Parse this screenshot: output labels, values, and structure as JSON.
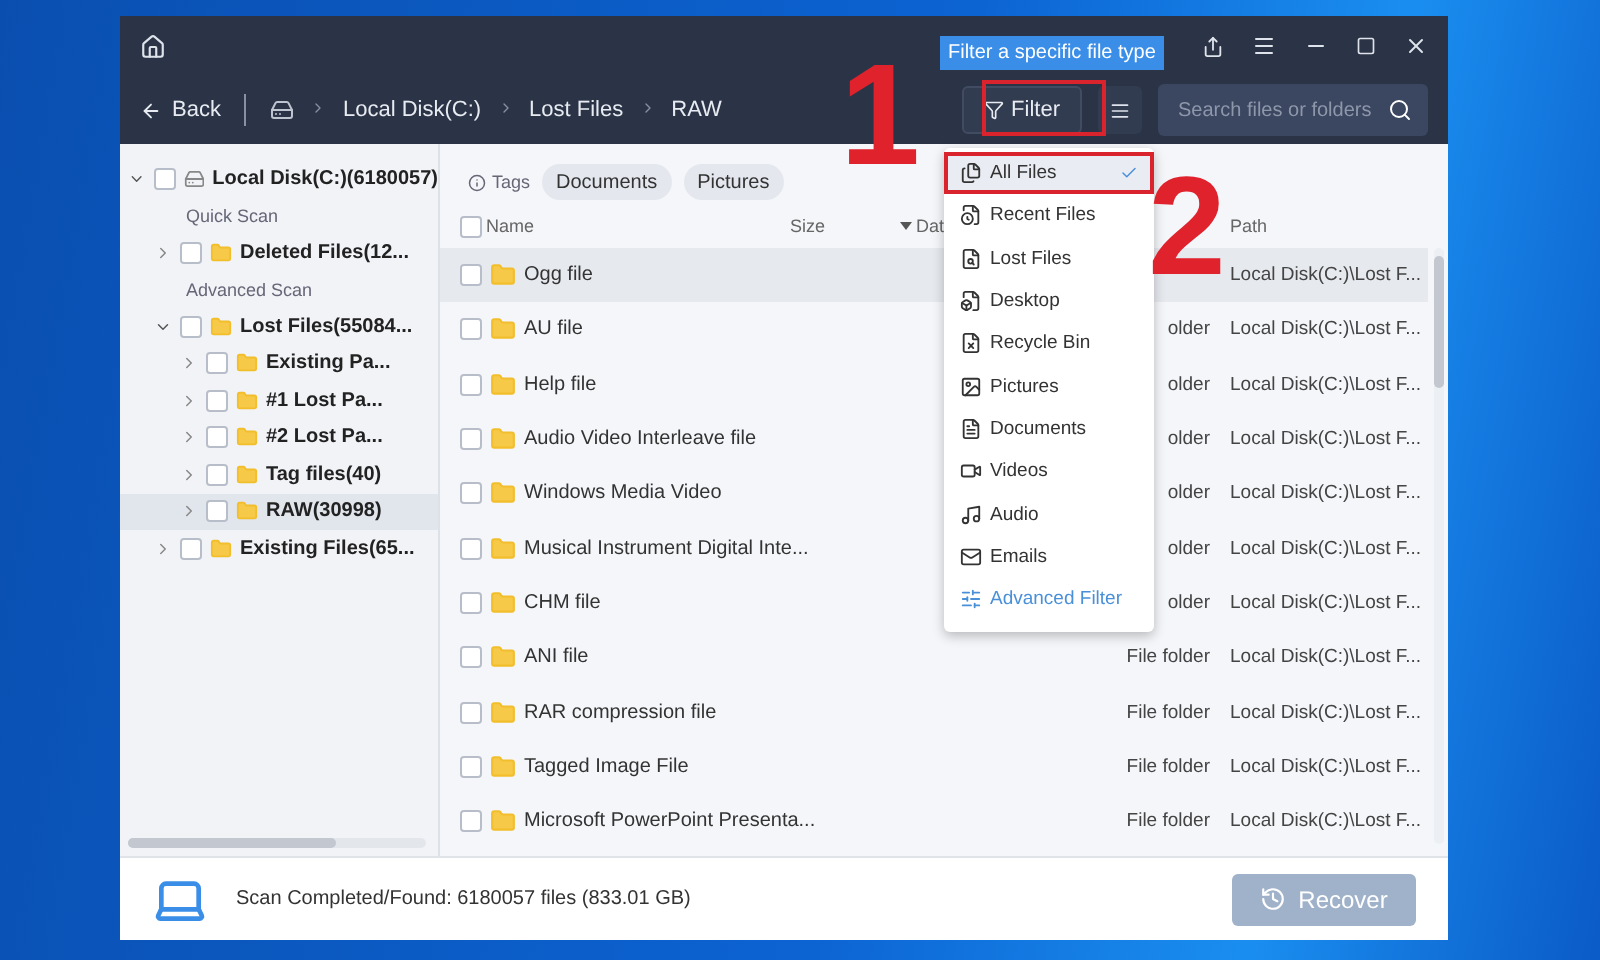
{
  "titlebar": {
    "tooltip": "Filter a specific file type"
  },
  "nav": {
    "back": "Back",
    "breadcrumbs": [
      "Local Disk(C:)",
      "Lost Files",
      "RAW"
    ],
    "filter": "Filter",
    "search": {
      "placeholder": "Search files or folders"
    }
  },
  "sidebar": {
    "tree": [
      {
        "kind": "node",
        "label": "Local Disk(C:)(6180057)",
        "expanded": true,
        "checked": false,
        "selected": false,
        "children": [
          {
            "kind": "section",
            "label": "Quick Scan"
          },
          {
            "kind": "node",
            "label": "Deleted Files(12...",
            "expanded": false,
            "checked": false,
            "selected": false
          },
          {
            "kind": "section",
            "label": "Advanced Scan"
          },
          {
            "kind": "node",
            "label": "Lost Files(55084...",
            "expanded": true,
            "checked": false,
            "selected": false,
            "children": [
              {
                "kind": "node",
                "label": "Existing Pa...",
                "expanded": false,
                "checked": false,
                "selected": false
              },
              {
                "kind": "node",
                "label": "#1 Lost Pa...",
                "expanded": false,
                "checked": false,
                "selected": false
              },
              {
                "kind": "node",
                "label": "#2 Lost Pa...",
                "expanded": false,
                "checked": false,
                "selected": false
              },
              {
                "kind": "node",
                "label": "Tag files(40)",
                "expanded": false,
                "checked": false,
                "selected": false
              },
              {
                "kind": "node",
                "label": "RAW(30998)",
                "expanded": false,
                "checked": false,
                "selected": true
              }
            ]
          },
          {
            "kind": "node",
            "label": "Existing Files(65...",
            "expanded": false,
            "checked": false,
            "selected": false
          }
        ]
      }
    ]
  },
  "tags": {
    "label": "Tags",
    "chips": [
      "Documents",
      "Pictures"
    ]
  },
  "table": {
    "select_all_checked": false,
    "columns": [
      {
        "label": "Name",
        "sorted": false
      },
      {
        "label": "Size",
        "sorted": false
      },
      {
        "label": "Dat",
        "sorted": true
      },
      {
        "label": "Path",
        "sorted": false
      }
    ],
    "rows": [
      {
        "name": "Ogg file",
        "path": "Local Disk(C:)\\Lost F...",
        "checked": false,
        "selected": true
      },
      {
        "name": "AU file",
        "type": "older",
        "path": "Local Disk(C:)\\Lost F...",
        "checked": false,
        "selected": false
      },
      {
        "name": "Help file",
        "type": "older",
        "path": "Local Disk(C:)\\Lost F...",
        "checked": false,
        "selected": false
      },
      {
        "name": "Audio Video Interleave file",
        "type": "older",
        "path": "Local Disk(C:)\\Lost F...",
        "checked": false,
        "selected": false
      },
      {
        "name": "Windows Media Video",
        "type": "older",
        "path": "Local Disk(C:)\\Lost F...",
        "checked": false,
        "selected": false
      },
      {
        "name": "Musical Instrument Digital Inte...",
        "type": "older",
        "path": "Local Disk(C:)\\Lost F...",
        "checked": false,
        "selected": false
      },
      {
        "name": "CHM file",
        "type": "older",
        "path": "Local Disk(C:)\\Lost F...",
        "checked": false,
        "selected": false
      },
      {
        "name": "ANI file",
        "type": "File folder",
        "path": "Local Disk(C:)\\Lost F...",
        "checked": false,
        "selected": false
      },
      {
        "name": "RAR compression file",
        "type": "File folder",
        "path": "Local Disk(C:)\\Lost F...",
        "checked": false,
        "selected": false
      },
      {
        "name": "Tagged Image File",
        "type": "File folder",
        "path": "Local Disk(C:)\\Lost F...",
        "checked": false,
        "selected": false
      },
      {
        "name": "Microsoft PowerPoint Presenta...",
        "type": "File folder",
        "path": "Local Disk(C:)\\Lost F...",
        "checked": false,
        "selected": false
      }
    ]
  },
  "filter_menu": {
    "items": [
      {
        "kind": "option",
        "label": "All Files",
        "selected": true
      },
      {
        "kind": "option",
        "label": "Recent Files",
        "selected": false
      },
      {
        "kind": "option",
        "label": "Lost Files",
        "selected": false
      },
      {
        "kind": "option",
        "label": "Desktop",
        "selected": false
      },
      {
        "kind": "option",
        "label": "Recycle Bin",
        "selected": false
      },
      {
        "kind": "option",
        "label": "Pictures",
        "selected": false
      },
      {
        "kind": "option",
        "label": "Documents",
        "selected": false
      },
      {
        "kind": "option",
        "label": "Videos",
        "selected": false
      },
      {
        "kind": "option",
        "label": "Audio",
        "selected": false
      },
      {
        "kind": "option",
        "label": "Emails",
        "selected": false
      },
      {
        "kind": "action",
        "label": "Advanced Filter",
        "selected": false
      }
    ]
  },
  "annotations": [
    {
      "label": "1"
    },
    {
      "label": "2"
    }
  ],
  "status_bar": {
    "text": "Scan Completed/Found: 6180057 files (833.01 GB)",
    "recover": "Recover",
    "recover_disabled": true
  }
}
